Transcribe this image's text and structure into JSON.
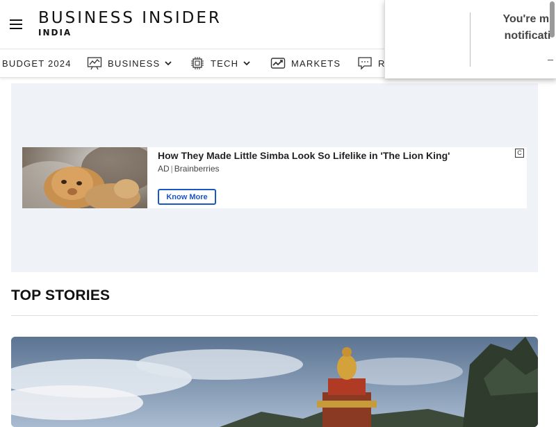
{
  "header": {
    "logo_main": "BUSINESS INSIDER",
    "logo_sub": "INDIA"
  },
  "nav": {
    "items": [
      {
        "label": "BUDGET 2024",
        "icon": "none"
      },
      {
        "label": "BUSINESS",
        "icon": "chart-icon"
      },
      {
        "label": "TECH",
        "icon": "chip-icon"
      },
      {
        "label": "MARKETS",
        "icon": "market-chart-icon"
      },
      {
        "label": "R",
        "icon": "chat-icon"
      }
    ]
  },
  "ad": {
    "title": "How They Made Little Simba Look So Lifelike in 'The Lion King'",
    "ad_tag": "AD",
    "source": "Brainberries",
    "button": "Know More",
    "choice_icon": "C"
  },
  "top_stories": {
    "title": "TOP STORIES"
  },
  "notification": {
    "line1": "You're mi",
    "line2": "notificati"
  },
  "colors": {
    "ad_background": "#eff2f7",
    "button_blue": "#1a56c4"
  }
}
